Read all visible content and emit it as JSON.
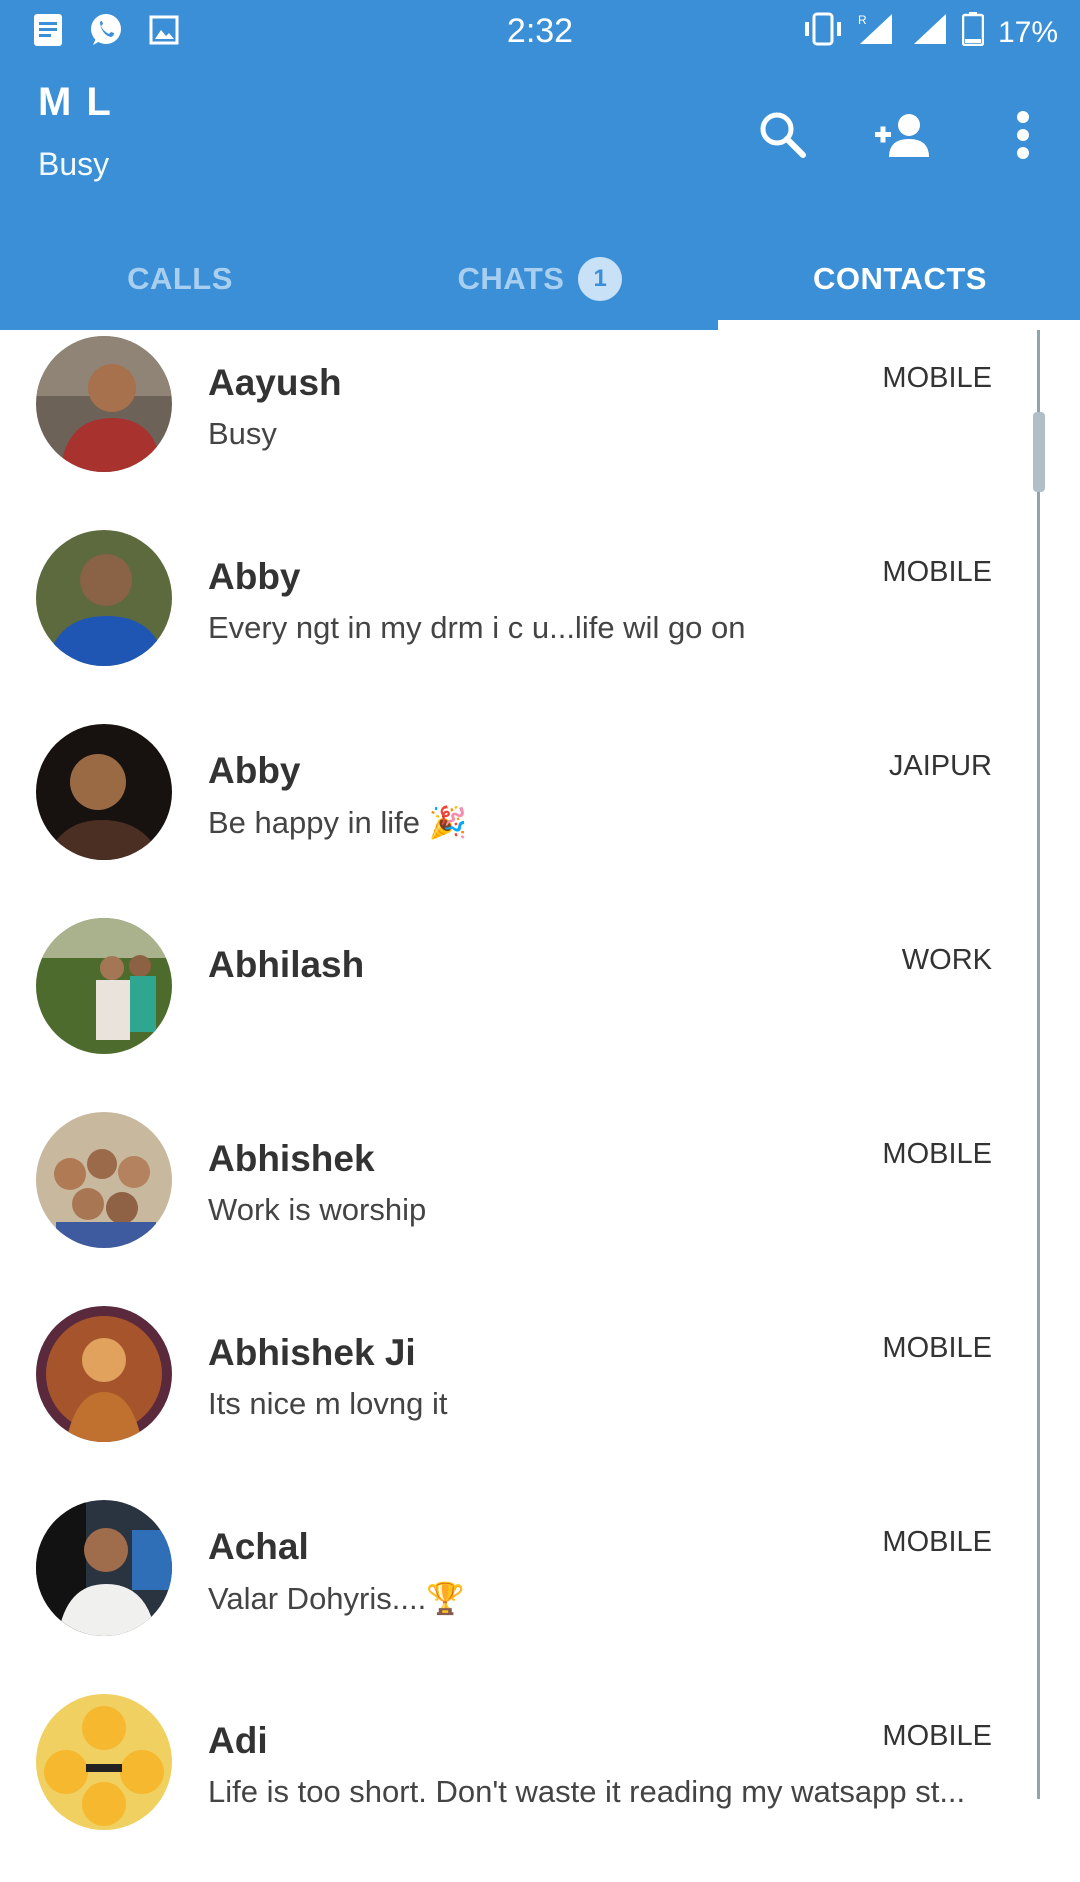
{
  "status_bar": {
    "time": "2:32",
    "battery": "17%",
    "icons": [
      "notes-icon",
      "whatsapp-icon",
      "image-icon",
      "vibrate-icon",
      "signal-icon",
      "signal-icon",
      "battery-icon"
    ]
  },
  "profile": {
    "name": "M       L",
    "status": "Busy"
  },
  "toolbar": {
    "icons": [
      "search-icon",
      "add-contact-icon",
      "more-vert-icon"
    ]
  },
  "tabs": [
    {
      "label": "CALLS"
    },
    {
      "label": "CHATS",
      "badge": "1"
    },
    {
      "label": "CONTACTS"
    }
  ],
  "active_tab": "CONTACTS",
  "colors": {
    "accent": "#3a8fd6",
    "tab_inactive": "#a9cff0",
    "text_primary": "#333333"
  },
  "contacts": [
    {
      "name": "Aayush",
      "status": "Busy",
      "type": "MOBILE"
    },
    {
      "name": "Abby",
      "status": "Every ngt in my drm i c u...life wil go on",
      "type": "MOBILE"
    },
    {
      "name": "Abby",
      "status": "Be happy in life 🎉",
      "type": "JAIPUR"
    },
    {
      "name": "Abhilash",
      "status": "",
      "type": "WORK"
    },
    {
      "name": "Abhishek",
      "status": "Work is worship",
      "type": "MOBILE"
    },
    {
      "name": "Abhishek Ji",
      "status": "Its nice m lovng it",
      "type": "MOBILE"
    },
    {
      "name": "Achal",
      "status": "Valar Dohyris....🏆",
      "type": "MOBILE"
    },
    {
      "name": "Adi",
      "status": "Life is too short. Don't waste it reading my watsapp st...",
      "type": "MOBILE"
    }
  ]
}
